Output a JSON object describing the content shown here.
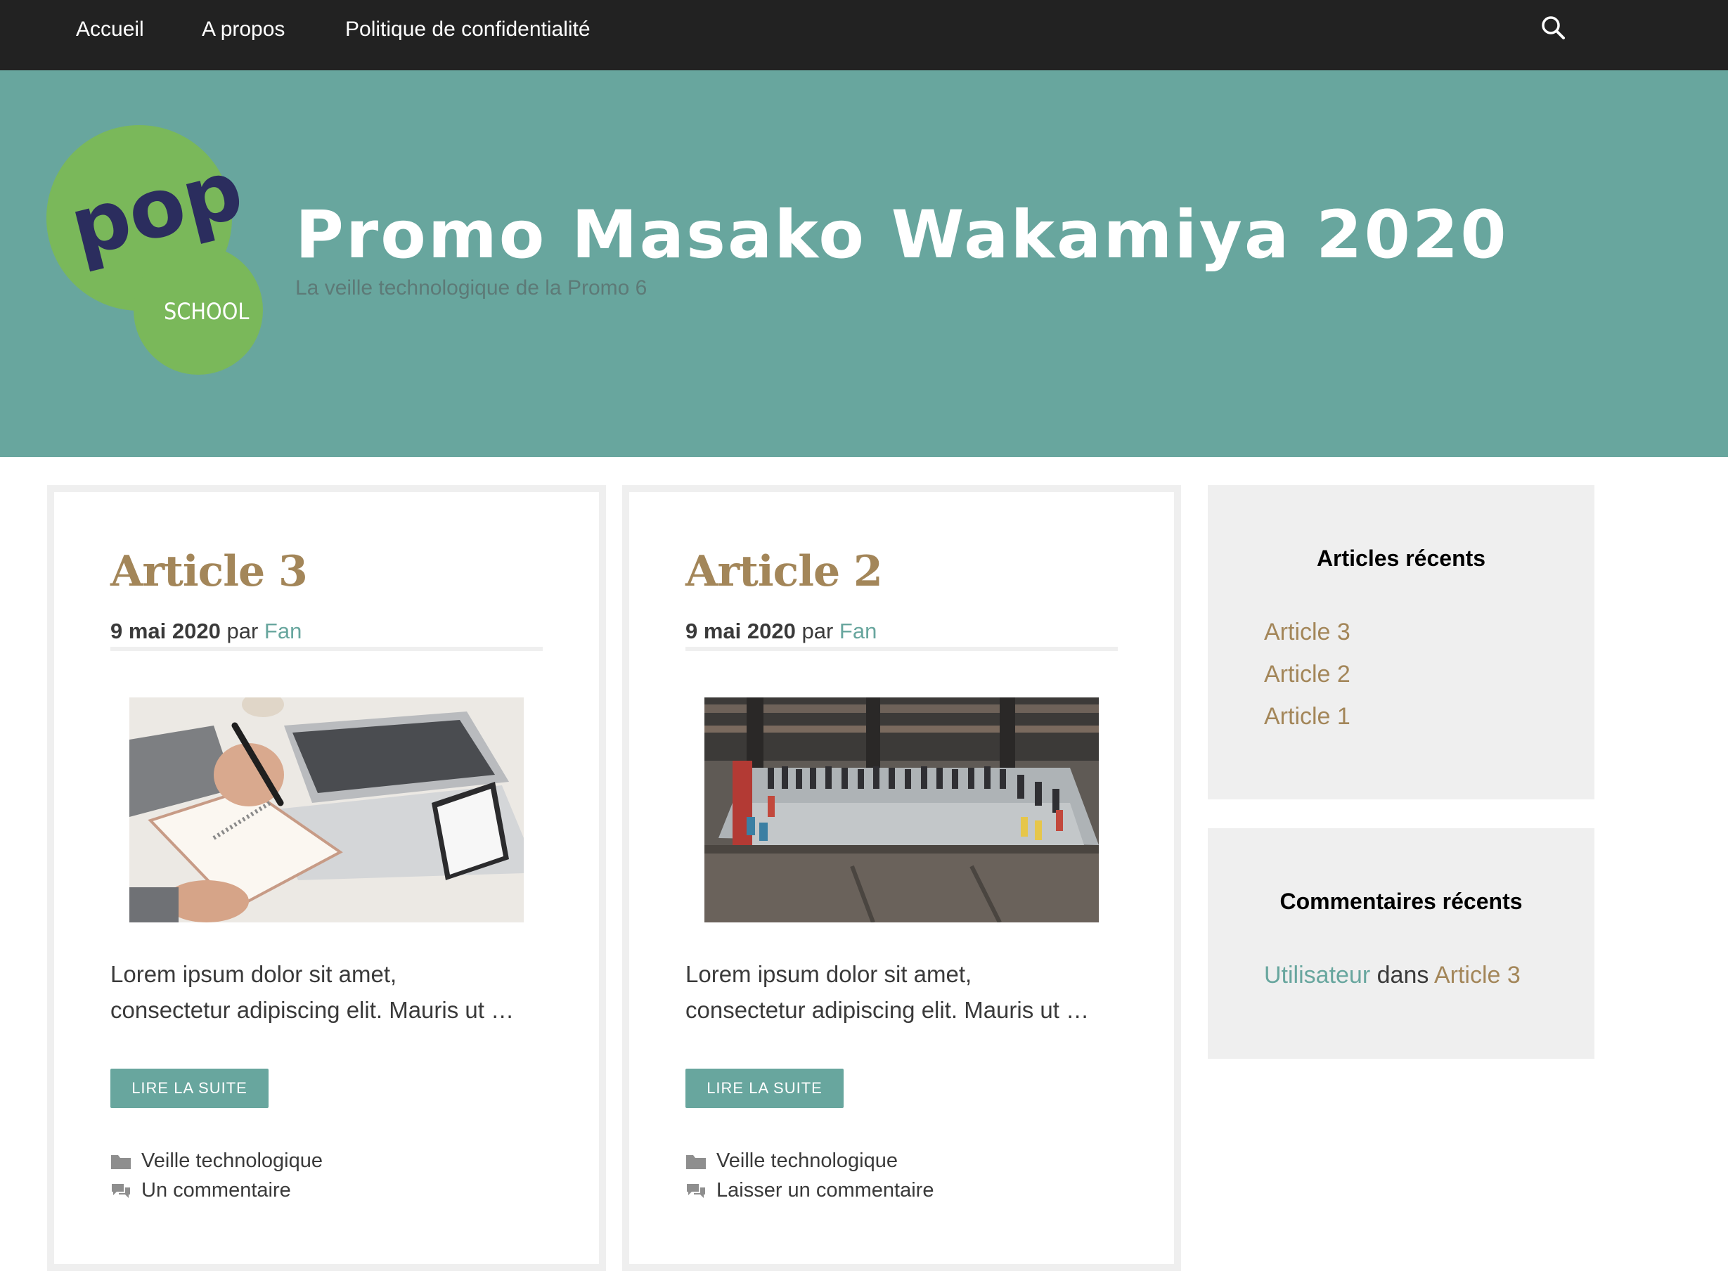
{
  "nav": {
    "items": [
      {
        "label": "Accueil"
      },
      {
        "label": "A propos"
      },
      {
        "label": "Politique de confidentialité"
      }
    ],
    "search_icon": "search-icon"
  },
  "header": {
    "logo": {
      "word": "pop",
      "sub": "SCHOOL"
    },
    "title": "Promo Masako Wakamiya 2020",
    "description": "La veille technologique de la Promo 6"
  },
  "posts": [
    {
      "title": "Article 3",
      "date": "9 mai 2020",
      "by": "par",
      "author": "Fan",
      "excerpt_line1": "Lorem ipsum dolor sit amet,",
      "excerpt_line2": "consectetur adipiscing elit. Mauris ut …",
      "read_more": "LIRE LA SUITE",
      "category": "Veille technologique",
      "comments": "Un commentaire"
    },
    {
      "title": "Article 2",
      "date": "9 mai 2020",
      "by": "par",
      "author": "Fan",
      "excerpt_line1": "Lorem ipsum dolor sit amet,",
      "excerpt_line2": "consectetur adipiscing elit. Mauris ut …",
      "read_more": "LIRE LA SUITE",
      "category": "Veille technologique",
      "comments": "Laisser un commentaire"
    }
  ],
  "sidebar": {
    "recent_posts": {
      "title": "Articles récents",
      "items": [
        "Article 3",
        "Article 2",
        "Article 1"
      ]
    },
    "recent_comments": {
      "title": "Commentaires récents",
      "user": "Utilisateur",
      "in": "dans",
      "post": "Article 3"
    }
  },
  "colors": {
    "nav_bg": "#222222",
    "header_bg": "#68a69e",
    "accent_teal": "#68a69e",
    "accent_gold": "#a38659",
    "logo_green": "#7ab85a",
    "logo_navy": "#2b2d5e"
  }
}
